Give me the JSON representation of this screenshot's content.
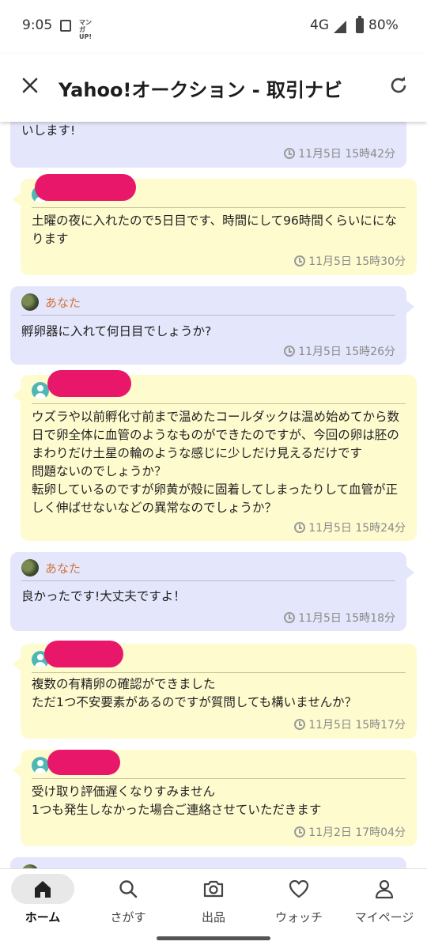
{
  "status_bar": {
    "time": "9:05",
    "manga_icon": "マンガUP!",
    "network": "4G",
    "battery": "80%"
  },
  "app_bar": {
    "title": "Yahoo!オークション - 取引ナビ",
    "close_icon": "close-icon",
    "refresh_icon": "refresh-icon"
  },
  "messages": [
    {
      "sender": "me",
      "name": "",
      "text": "いします!",
      "time": "11月5日 15時42分"
    },
    {
      "sender": "other",
      "name": "",
      "text": "土曜の夜に入れたので5日目です、時間にして96時間くらいにになります",
      "time": "11月5日 15時30分"
    },
    {
      "sender": "me",
      "name": "あなた",
      "text": "孵卵器に入れて何日目でしょうか?",
      "time": "11月5日 15時26分"
    },
    {
      "sender": "other",
      "name": "",
      "text": "ウズラや以前孵化寸前まで温めたコールダックは温め始めてから数日で卵全体に血管のようなものができたのですが、今回の卵は胚のまわりだけ土星の輪のような感じに少しだけ見えるだけです\n問題ないのでしょうか？\n転卵しているのですが卵黄が殻に固着してしまったりして血管が正しく伸ばせないなどの異常なのでしょうか？",
      "time": "11月5日 15時24分"
    },
    {
      "sender": "me",
      "name": "あなた",
      "text": "良かったです!大丈夫ですよ！",
      "time": "11月5日 15時18分"
    },
    {
      "sender": "other",
      "name": "",
      "text": "複数の有精卵の確認ができました\nただ1つ不安要素があるのですが質問しても構いませんか？",
      "time": "11月5日 15時17分"
    },
    {
      "sender": "other",
      "name": "",
      "text": "受け取り評価遅くなりすみません\n1つも発生しなかった場合ご連絡させていただきます",
      "time": "11月2日 17時04分"
    }
  ],
  "bottom_nav": [
    {
      "label": "ホーム",
      "icon": "home-icon",
      "active": true
    },
    {
      "label": "さがす",
      "icon": "search-icon",
      "active": false
    },
    {
      "label": "出品",
      "icon": "camera-icon",
      "active": false
    },
    {
      "label": "ウォッチ",
      "icon": "heart-icon",
      "active": false
    },
    {
      "label": "マイページ",
      "icon": "person-icon",
      "active": false
    }
  ],
  "colors": {
    "my_bubble": "#e4e6fb",
    "other_bubble": "#fefbcf",
    "sender_name": "#d2733a",
    "redaction": "#e8176a"
  }
}
